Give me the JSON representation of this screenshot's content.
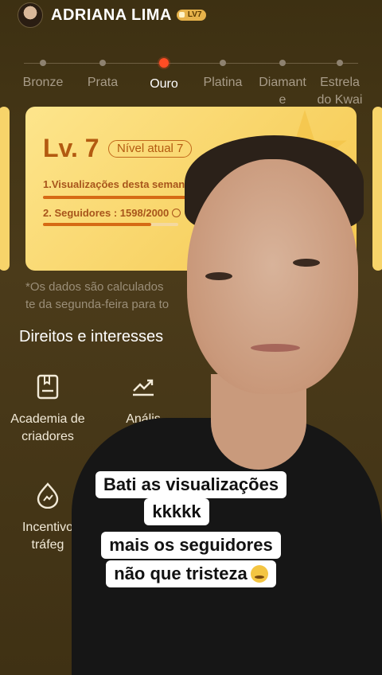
{
  "header": {
    "username": "ADRIANA LIMA",
    "level_badge": "LV7"
  },
  "tiers": [
    {
      "label": "Bronze",
      "active": false
    },
    {
      "label": "Prata",
      "active": false
    },
    {
      "label": "Ouro",
      "active": true
    },
    {
      "label": "Platina",
      "active": false
    },
    {
      "label": "Diamant\ne",
      "active": false
    },
    {
      "label": "Estrela\ndo Kwai",
      "active": false
    }
  ],
  "card": {
    "level": "Lv. 7",
    "current_level_pill": "Nível atual 7",
    "requirement_1": "1.Visualizações desta semana",
    "requirement_2": "2. Seguidores : 1598/2000",
    "req2_progress": 0.799
  },
  "note": "*Os dados são calculados\nte da segunda-feira para to",
  "section_title": "Direitos e interesses",
  "features": [
    {
      "label": "Academia de\ncriadores",
      "icon": "book-icon"
    },
    {
      "label": "Anális",
      "icon": "trend-chart-icon"
    },
    {
      "label": "Incentivo\ntráfeg",
      "icon": "flame-icon"
    }
  ],
  "caption": {
    "line1": "Bati as visualizações",
    "line2": "kkkkk",
    "line3": "mais os seguidores",
    "line4": "não que tristeza",
    "emoji": "crying-cat-emoji"
  },
  "colors": {
    "accent": "#ff4d24",
    "card": "#f8d366",
    "level_text": "#b35a10"
  }
}
